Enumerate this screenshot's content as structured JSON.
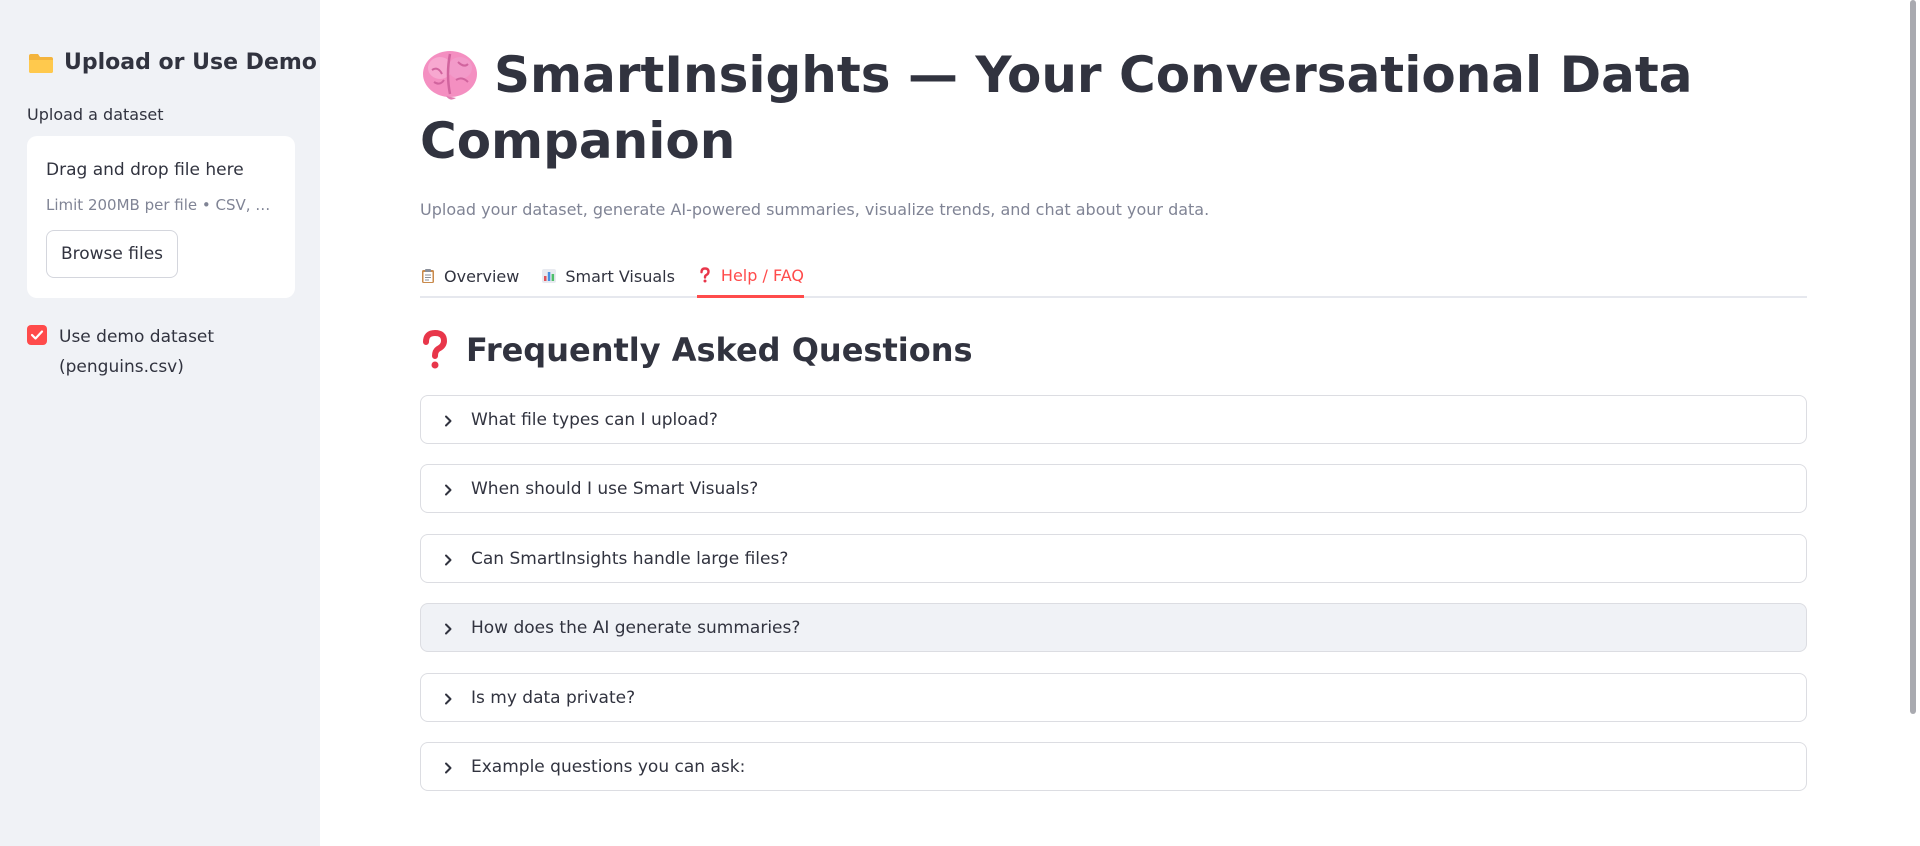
{
  "sidebar": {
    "title": "Upload or Use Demo",
    "title_icon": "folder-icon",
    "upload_label": "Upload a dataset",
    "dropzone": {
      "title": "Drag and drop file here",
      "limit": "Limit 200MB per file • CSV, X...",
      "browse_label": "Browse files"
    },
    "demo_checkbox": {
      "label": "Use demo dataset (penguins.csv)",
      "checked": true
    }
  },
  "main": {
    "title": "SmartInsights — Your Conversational Data Companion",
    "title_icon": "brain-icon",
    "subtitle": "Upload your dataset, generate AI-powered summaries, visualize trends, and chat about your data.",
    "tabs": [
      {
        "label": "Overview",
        "icon": "clipboard-icon",
        "active": false
      },
      {
        "label": "Smart Visuals",
        "icon": "bar-chart-icon",
        "active": false
      },
      {
        "label": "Help / FAQ",
        "icon": "question-icon",
        "active": true
      }
    ],
    "faq": {
      "heading": "Frequently Asked Questions",
      "heading_icon": "question-mark-icon",
      "items": [
        {
          "label": "What file types can I upload?"
        },
        {
          "label": "When should I use Smart Visuals?"
        },
        {
          "label": "Can SmartInsights handle large files?"
        },
        {
          "label": "How does the AI generate summaries?",
          "hovered": true
        },
        {
          "label": "Is my data private?"
        },
        {
          "label": "Example questions you can ask:"
        }
      ]
    }
  },
  "colors": {
    "accent": "#ff4b4b",
    "sidebar_bg": "#f0f2f6",
    "text": "#31333f",
    "muted": "#808495"
  }
}
